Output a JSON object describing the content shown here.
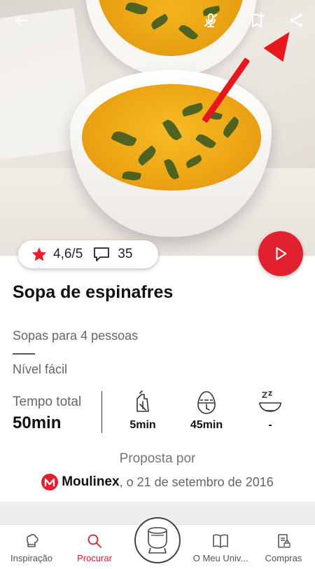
{
  "colors": {
    "accent": "#e2202e",
    "active_nav": "#d51f2b",
    "star": "#e2202e"
  },
  "header": {
    "back_icon": "arrow-left-icon",
    "mute_icon": "mic-off-icon",
    "bookmark_icon": "bookmark-add-icon",
    "share_icon": "share-icon"
  },
  "rating": {
    "score": "4,6/5",
    "comments": "35"
  },
  "recipe": {
    "title": "Sopa de espinafres",
    "subtitle": "Sopas para 4 pessoas",
    "level": "Nível fácil"
  },
  "times": {
    "total_label": "Tempo total",
    "total_value": "50min",
    "prep": "5min",
    "cook": "45min",
    "rest": "-"
  },
  "author": {
    "proposed_by": "Proposta por",
    "brand": "Moulinex",
    "date_text": ", o 21 de setembro de 2016"
  },
  "nav": {
    "items": [
      {
        "label": "Inspiração"
      },
      {
        "label": "Procurar"
      },
      {
        "label": "O Meu Univ..."
      },
      {
        "label": "Compras"
      }
    ]
  }
}
